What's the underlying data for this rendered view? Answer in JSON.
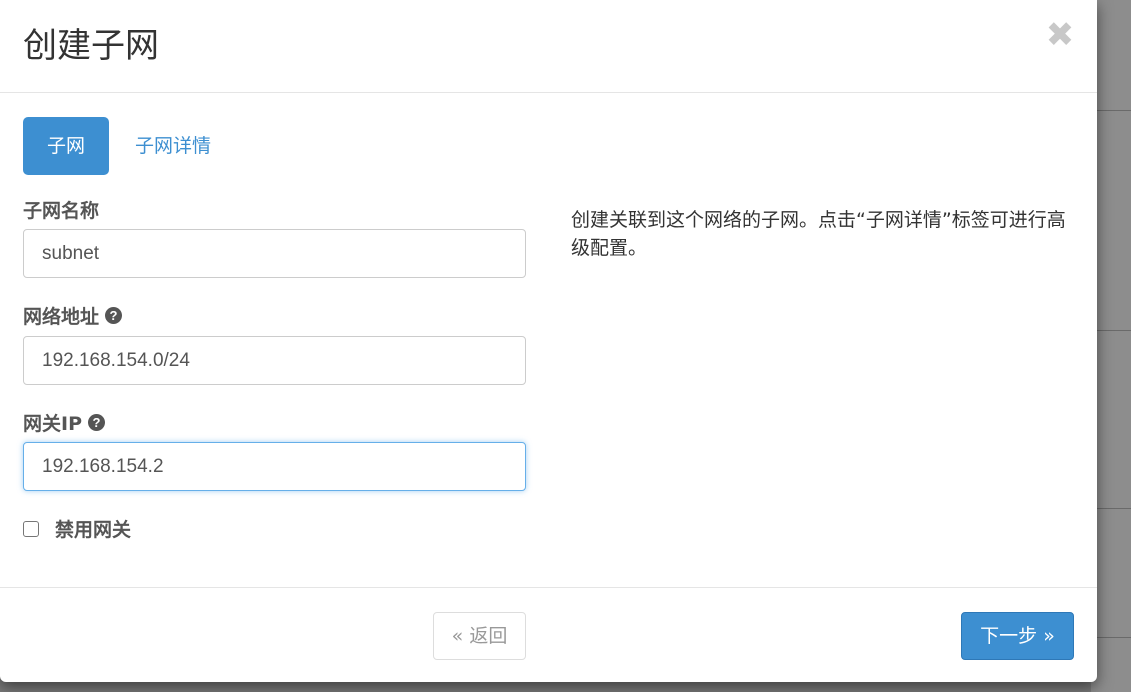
{
  "dialog": {
    "title": "创建子网",
    "close_icon": "close-icon",
    "close_glyph": "✖"
  },
  "tabs": [
    {
      "label": "子网",
      "active": true
    },
    {
      "label": "子网详情",
      "active": false
    }
  ],
  "form": {
    "subnet_name": {
      "label": "子网名称",
      "value": "subnet"
    },
    "network_address": {
      "label": "网络地址",
      "value": "192.168.154.0/24",
      "help_icon": "question-circle-icon"
    },
    "gateway_ip": {
      "label": "网关IP",
      "value": "192.168.154.2",
      "help_icon": "question-circle-icon",
      "focused": true
    },
    "disable_gateway": {
      "label": "禁用网关",
      "checked": false
    },
    "help_glyph": "?"
  },
  "help_text": "创建关联到这个网络的子网。点击“子网详情”标签可进行高级配置。",
  "footer": {
    "back_label": "« 返回",
    "next_label": "下一步 »"
  },
  "colors": {
    "primary": "#3d8fd1",
    "focus_border": "#66afe9",
    "text_dark": "#333333",
    "label": "#555555"
  }
}
